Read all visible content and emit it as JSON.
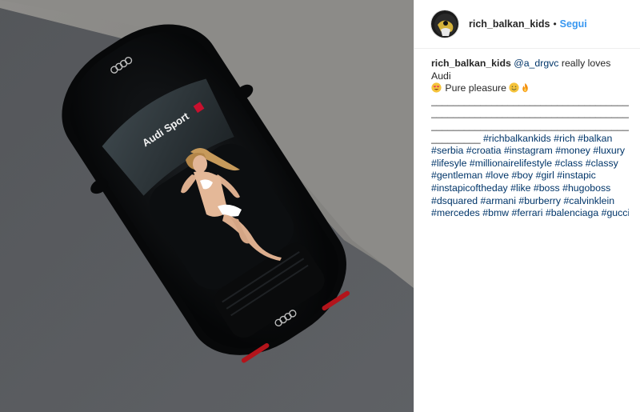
{
  "header": {
    "username": "rich_balkan_kids",
    "separator": "•",
    "follow_label": "Segui"
  },
  "caption": {
    "username": "rich_balkan_kids",
    "mention": "@a_drgvc",
    "text_line1": " really loves Audi",
    "pure_pleasure": " Pure pleasure ",
    "emoji_icons": [
      "heart-eyes-emoji-icon",
      "smile-emoji-icon",
      "fire-emoji-icon"
    ],
    "underscore_line_1": "______________________________________",
    "underscore_line_2": "______________________________________",
    "underscore_line_3": "______________________________________",
    "underscore_prefix": "_________ ",
    "hashtag_lines": [
      [
        "#richbalkankids",
        "#rich",
        "#balkan"
      ],
      [
        "#serbia",
        "#croatia",
        "#instagram",
        "#money",
        "#luxury"
      ],
      [
        "#lifesyle",
        "#millionairelifestyle",
        "#class",
        "#classy"
      ],
      [
        "#gentleman",
        "#love",
        "#boy",
        "#girl",
        "#instapic"
      ],
      [
        "#instapicoftheday",
        "#like",
        "#boss",
        "#hugoboss"
      ],
      [
        "#dsquared",
        "#armani",
        "#burberry",
        "#calvinklein"
      ],
      [
        "#mercedes",
        "#bmw",
        "#ferrari",
        "#balenciaga",
        "#gucci"
      ]
    ]
  },
  "photo": {
    "roof_text": "Audi Sport"
  },
  "colors": {
    "link": "#003569",
    "follow": "#3897f0",
    "text": "#262626"
  }
}
